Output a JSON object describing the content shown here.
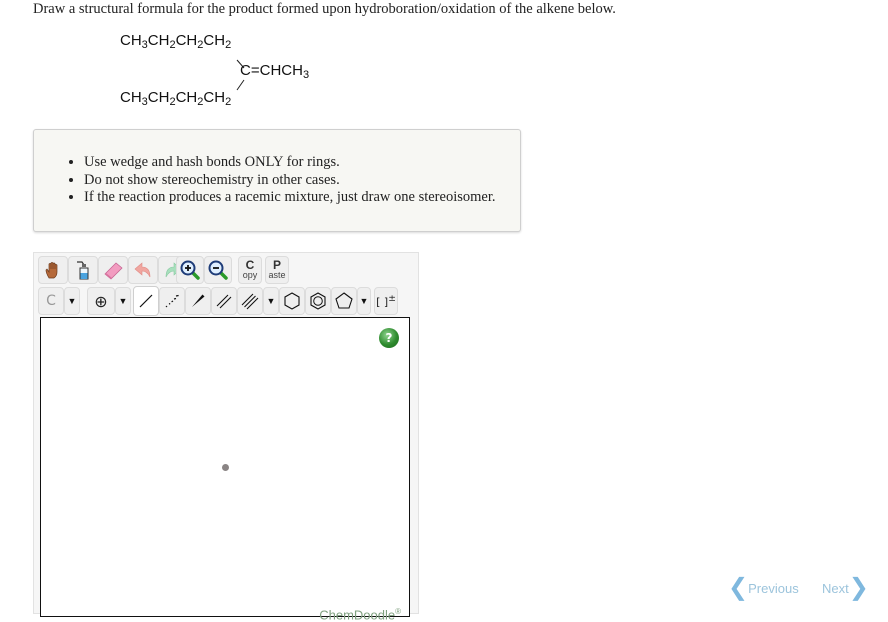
{
  "question": {
    "text": "Draw a structural formula for the product formed upon hydroboration/oxidation of the alkene below."
  },
  "molecule": {
    "top_chain": [
      "CH",
      "3",
      "CH",
      "2",
      "CH",
      "2",
      "CH",
      "2"
    ],
    "bottom_chain": [
      "CH",
      "3",
      "CH",
      "2",
      "CH",
      "2",
      "CH",
      "2"
    ],
    "center_carbon": "C",
    "double_bond": "=",
    "right_group": [
      "CHCH",
      "3"
    ]
  },
  "instructions": {
    "items": [
      "Use wedge and hash bonds ONLY for rings.",
      "Do not show stereochemistry in other cases.",
      "If the reaction produces a racemic mixture, just draw one stereoisomer."
    ]
  },
  "sketcher": {
    "toolbar_row1": [
      {
        "name": "hand-icon",
        "label": "Pan"
      },
      {
        "name": "wash-bottle-icon",
        "label": "Clear"
      },
      {
        "name": "eraser-icon",
        "label": "Erase"
      },
      {
        "name": "undo-icon",
        "label": "Undo"
      },
      {
        "name": "redo-icon",
        "label": "Redo"
      },
      {
        "name": "zoom-in-icon",
        "label": "Zoom In"
      },
      {
        "name": "zoom-out-icon",
        "label": "Zoom Out"
      }
    ],
    "copy": {
      "big": "C",
      "small": "opy"
    },
    "paste": {
      "big": "P",
      "small": "aste"
    },
    "atom_label": "C",
    "dropdown_glyph": "▼",
    "charge_glyph": "⊕",
    "bracket_label": "[ ]",
    "bracket_sup": "±",
    "help_glyph": "?",
    "watermark": "ChemDoodle",
    "watermark_mark": "®"
  },
  "navigation": {
    "previous_label": "Previous",
    "next_label": "Next",
    "previous_chevron": "❮",
    "next_chevron": "❯"
  },
  "colors": {
    "nav_text": "#9cc4dc",
    "help_green": "#2e8b2e",
    "instructions_bg": "#f7f7f3"
  }
}
